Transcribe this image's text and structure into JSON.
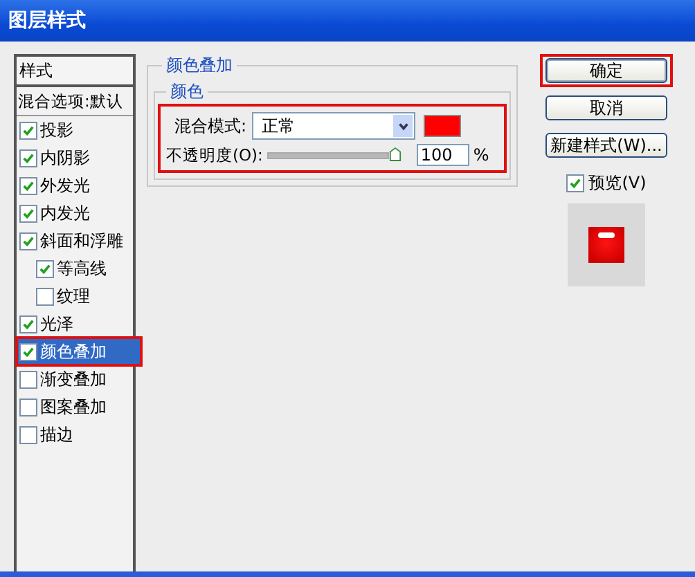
{
  "window": {
    "title": "图层样式"
  },
  "styles_panel": {
    "header": "样式",
    "blend_options": "混合选项:默认",
    "items": [
      {
        "label": "投影",
        "checked": true,
        "selected": false,
        "highlighted": false
      },
      {
        "label": "内阴影",
        "checked": true,
        "selected": false,
        "highlighted": false
      },
      {
        "label": "外发光",
        "checked": true,
        "selected": false,
        "highlighted": false
      },
      {
        "label": "内发光",
        "checked": true,
        "selected": false,
        "highlighted": false
      },
      {
        "label": "斜面和浮雕",
        "checked": true,
        "selected": false,
        "highlighted": false,
        "children": [
          {
            "label": "等高线",
            "checked": true,
            "selected": false,
            "highlighted": false
          },
          {
            "label": "纹理",
            "checked": false,
            "selected": false,
            "highlighted": false
          }
        ]
      },
      {
        "label": "光泽",
        "checked": true,
        "selected": false,
        "highlighted": false
      },
      {
        "label": "颜色叠加",
        "checked": true,
        "selected": true,
        "highlighted": true
      },
      {
        "label": "渐变叠加",
        "checked": false,
        "selected": false,
        "highlighted": false
      },
      {
        "label": "图案叠加",
        "checked": false,
        "selected": false,
        "highlighted": false
      },
      {
        "label": "描边",
        "checked": false,
        "selected": false,
        "highlighted": false
      }
    ]
  },
  "color_overlay": {
    "title": "颜色叠加",
    "group_title": "颜色",
    "highlighted": true,
    "blend_mode_label": "混合模式:",
    "blend_mode": "正常",
    "color": "#ff0000",
    "opacity_label": "不透明度(O):",
    "opacity": {
      "level": 1
    },
    "opacity_value": "100",
    "opacity_unit": "%"
  },
  "buttons": [
    {
      "label": "确定",
      "highlighted": true,
      "default": true
    },
    {
      "label": "取消",
      "highlighted": false,
      "default": false
    },
    {
      "label": "新建样式(W)...",
      "highlighted": false,
      "default": false
    }
  ],
  "preview": {
    "label": "预览(V)",
    "checked": true
  }
}
